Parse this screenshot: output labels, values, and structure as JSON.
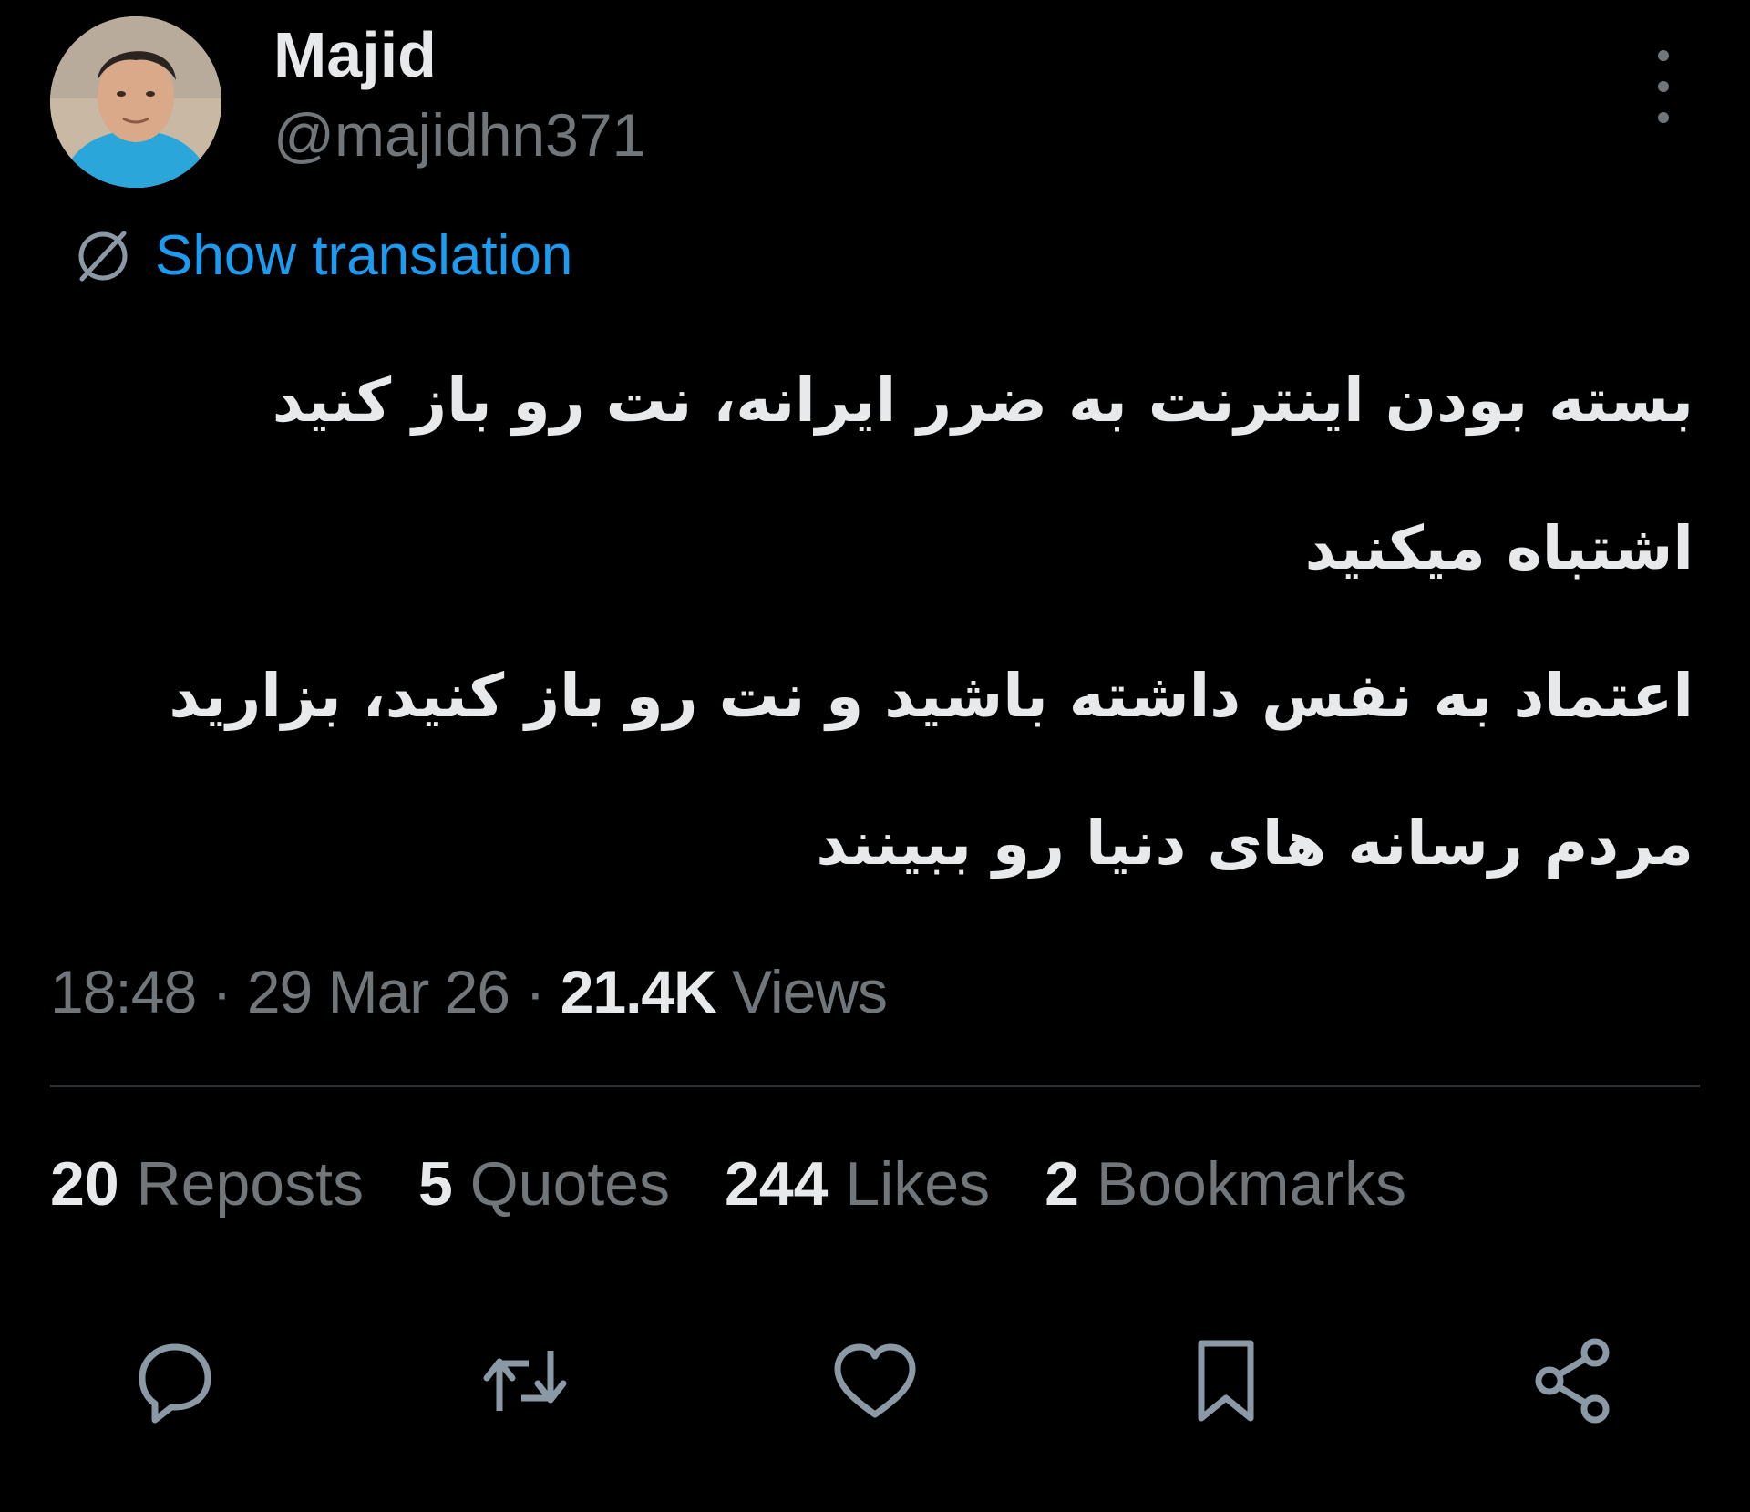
{
  "author": {
    "name": "Majid",
    "handle": "@majidhn371"
  },
  "translation": {
    "label": "Show translation",
    "icon": "globe-slash-icon"
  },
  "tweet": {
    "lines": [
      "بسته بودن اینترنت به ضرر ایرانه، نت رو باز کنید",
      "اشتباه میکنید",
      "اعتماد به نفس داشته باشید و نت رو باز کنید، بزارید",
      "مردم رسانه های دنیا رو ببینند"
    ]
  },
  "meta": {
    "time": "18:48",
    "separator": "·",
    "date": "29 Mar 26",
    "views_count": "21.4K",
    "views_label": "Views"
  },
  "stats": {
    "reposts": {
      "count": "20",
      "label": "Reposts"
    },
    "quotes": {
      "count": "5",
      "label": "Quotes"
    },
    "likes": {
      "count": "244",
      "label": "Likes"
    },
    "bookmarks": {
      "count": "2",
      "label": "Bookmarks"
    }
  },
  "actions": [
    "reply-icon",
    "repost-icon",
    "like-icon",
    "bookmark-icon",
    "share-icon"
  ],
  "colors": {
    "background": "#000000",
    "text": "#e7e9ea",
    "muted": "#71767b",
    "link": "#1d9bf0",
    "divider": "#2f3336"
  }
}
